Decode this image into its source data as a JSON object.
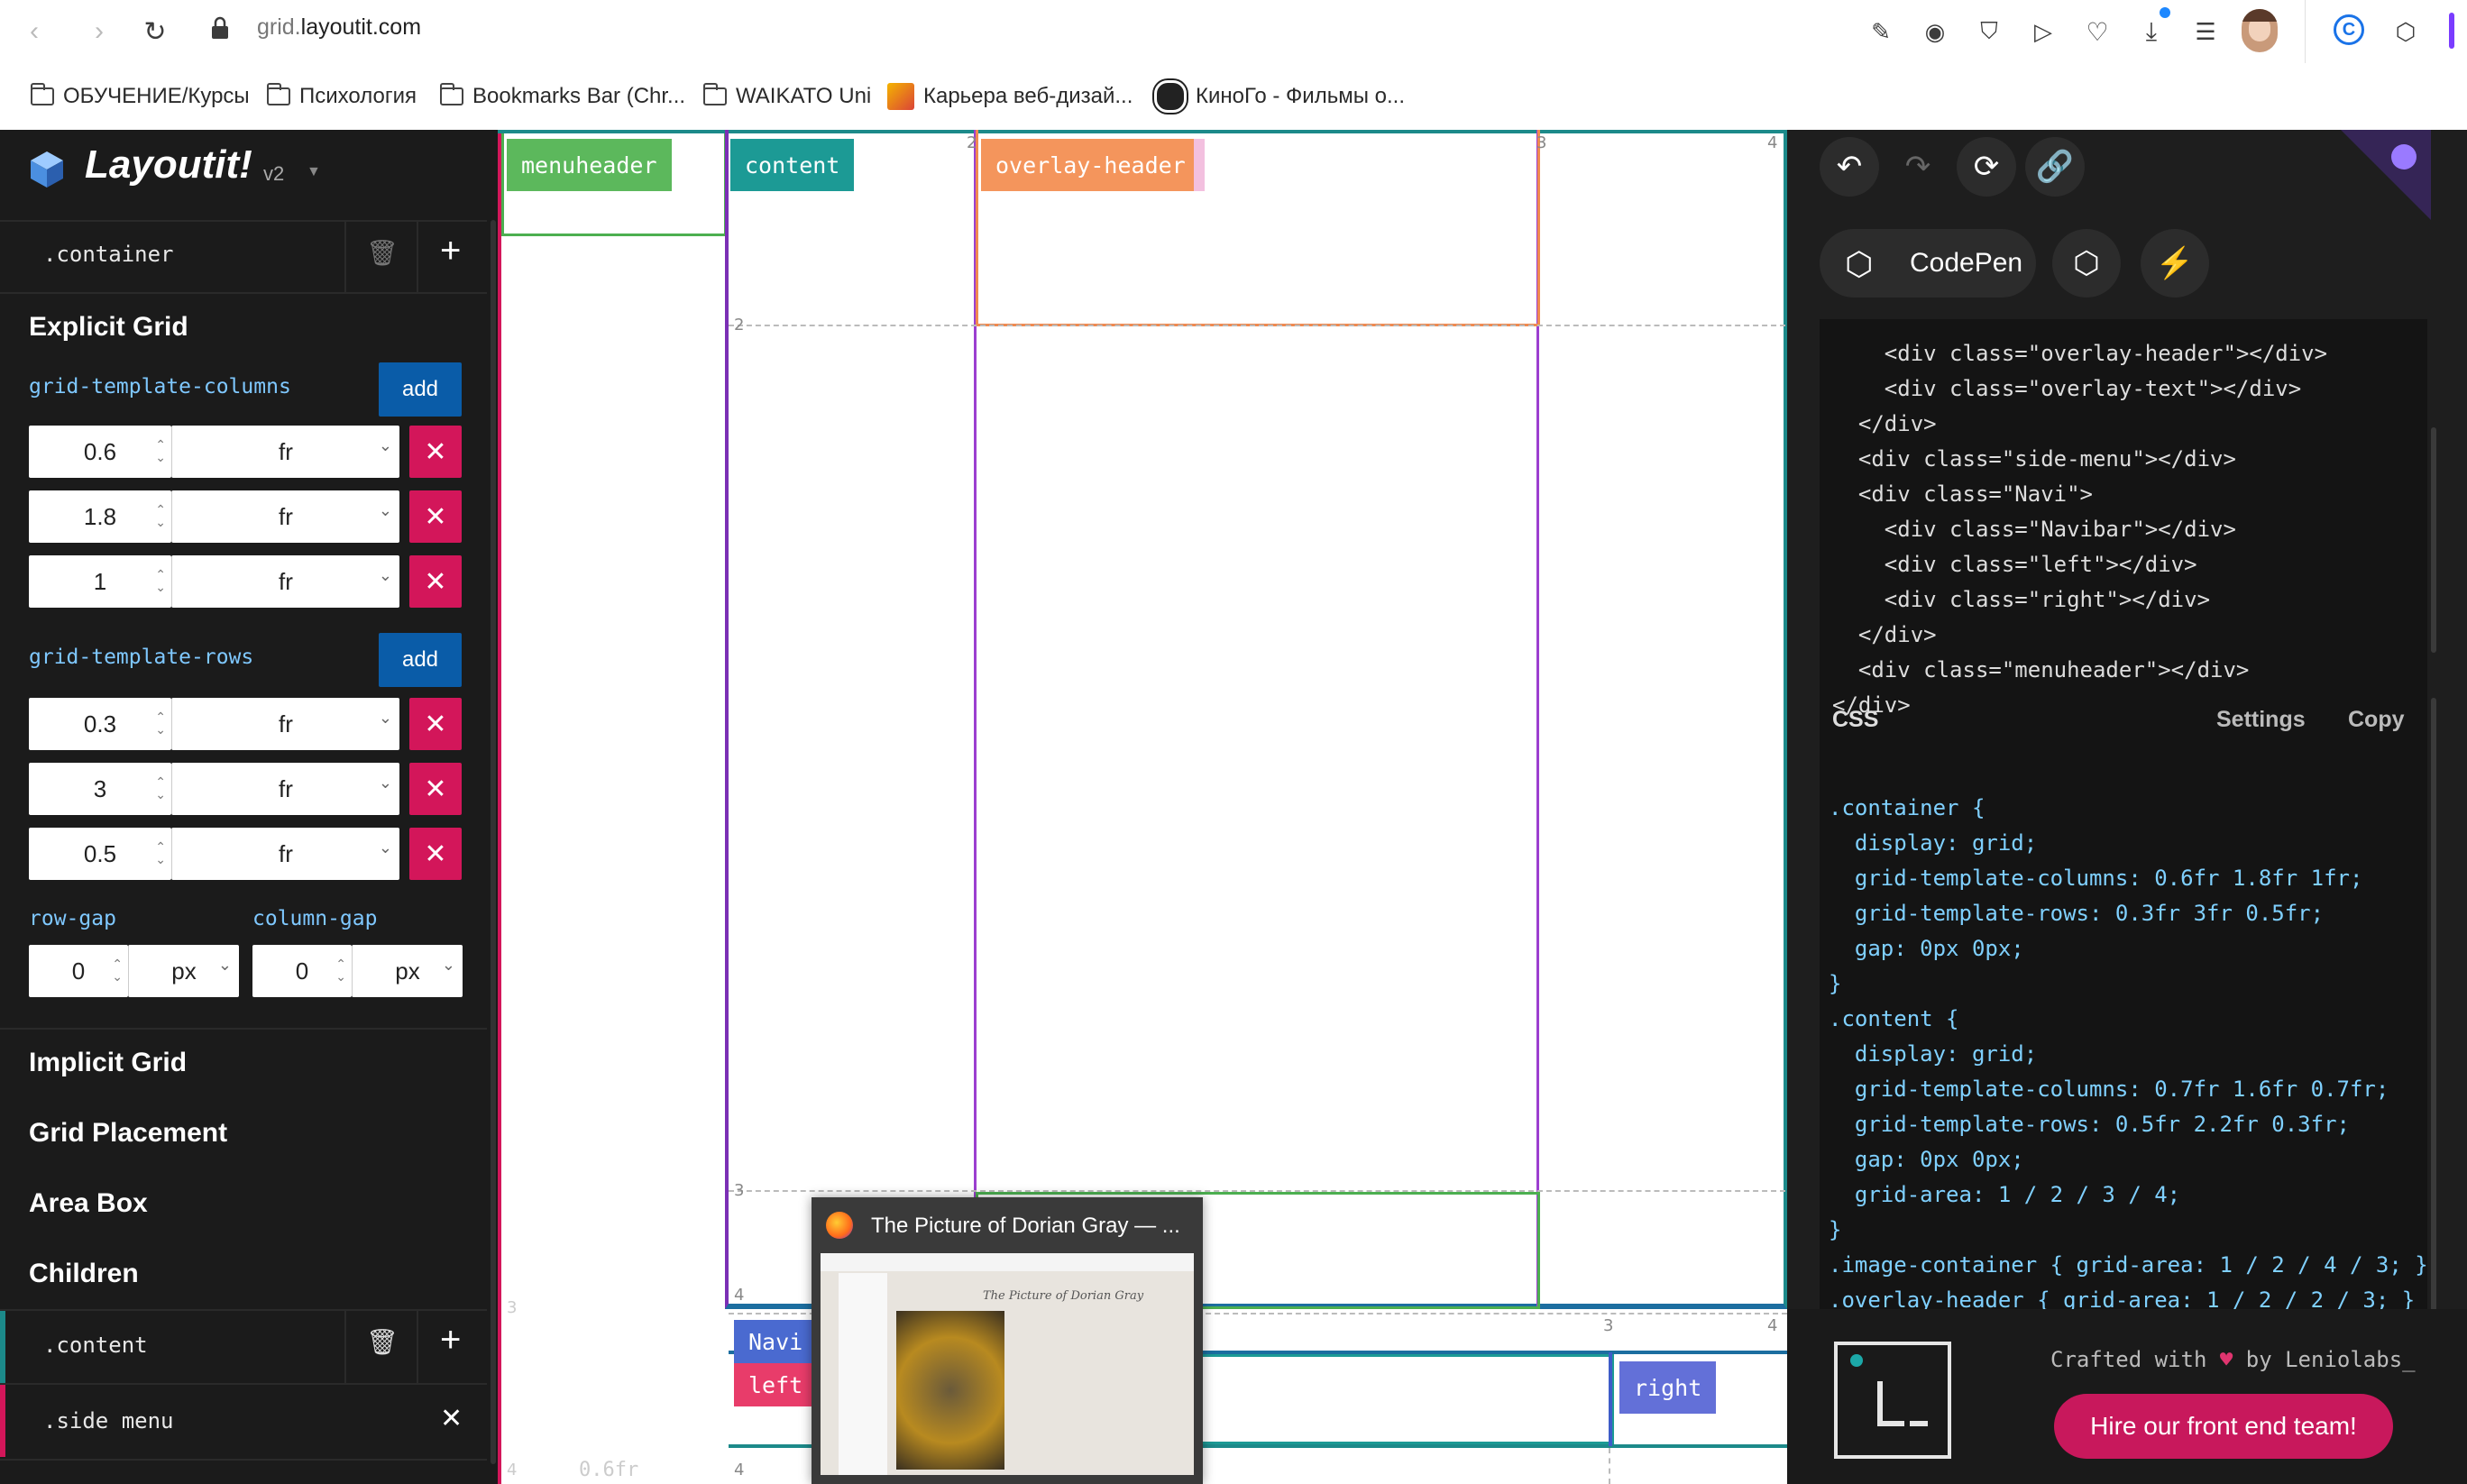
{
  "browser": {
    "url": "grid.layoutit.com",
    "url_domain": "grid.",
    "url_rest": "layoutit.com",
    "bookmarks": [
      {
        "label": "ОБУЧЕНИЕ/Курсы",
        "icon": "folder-icon"
      },
      {
        "label": "Психология",
        "icon": "folder-icon"
      },
      {
        "label": "Bookmarks Bar (Chr...",
        "icon": "folder-icon"
      },
      {
        "label": "WAIKATO Uni",
        "icon": "folder-icon"
      },
      {
        "label": "Карьера веб-дизай...",
        "icon": "site-icon"
      },
      {
        "label": "КиноГо - Фильмы о...",
        "icon": "site-icon"
      }
    ]
  },
  "app": {
    "title": "Layoutit!",
    "version": "v2",
    "container_selector": ".container",
    "explicit_grid_title": "Explicit Grid",
    "columns_label": "grid-template-columns",
    "rows_label": "grid-template-rows",
    "add_label": "add",
    "columns": [
      {
        "value": "0.6",
        "unit": "fr"
      },
      {
        "value": "1.8",
        "unit": "fr"
      },
      {
        "value": "1",
        "unit": "fr"
      }
    ],
    "rows": [
      {
        "value": "0.3",
        "unit": "fr"
      },
      {
        "value": "3",
        "unit": "fr"
      },
      {
        "value": "0.5",
        "unit": "fr"
      }
    ],
    "row_gap_label": "row-gap",
    "column_gap_label": "column-gap",
    "row_gap": {
      "value": "0",
      "unit": "px"
    },
    "column_gap": {
      "value": "0",
      "unit": "px"
    },
    "sections": [
      "Implicit Grid",
      "Grid Placement",
      "Area Box",
      "Children"
    ],
    "children": [
      ".content",
      ".side menu"
    ]
  },
  "canvas": {
    "areas": {
      "menuheader": "menuheader",
      "content": "content",
      "overlay_header": "overlay-header",
      "navi": "Navi",
      "left": "left",
      "right": "right",
      "navibar": "Navibar"
    },
    "ticks": {
      "t1": "2",
      "t2": "3",
      "t3": "4",
      "t4": "2",
      "t5": "3",
      "t6": "4",
      "t7": "3",
      "t8": "4",
      "t9": "3",
      "t10": "4",
      "t11": "4"
    },
    "col_size_hint": "0.6fr"
  },
  "popup": {
    "title": "The Picture of Dorian Gray — ...",
    "doc_title": "The Picture of Dorian Gray"
  },
  "right_panel": {
    "codepen_label": "CodePen",
    "html_lines": [
      "    <div class=\"overlay-header\"></div>",
      "    <div class=\"overlay-text\"></div>",
      "  </div>",
      "  <div class=\"side-menu\"></div>",
      "  <div class=\"Navi\">",
      "    <div class=\"Navibar\"></div>",
      "    <div class=\"left\"></div>",
      "    <div class=\"right\"></div>",
      "  </div>",
      "  <div class=\"menuheader\"></div>",
      "</div>"
    ],
    "css_title": "CSS",
    "settings_label": "Settings",
    "copy_label": "Copy",
    "css_lines": [
      ".container {",
      "  display: grid;",
      "  grid-template-columns: 0.6fr 1.8fr 1fr;",
      "  grid-template-rows: 0.3fr 3fr 0.5fr;",
      "  gap: 0px 0px;",
      "}",
      ".content {",
      "  display: grid;",
      "  grid-template-columns: 0.7fr 1.6fr 0.7fr;",
      "  grid-template-rows: 0.5fr 2.2fr 0.3fr;",
      "  gap: 0px 0px;",
      "  grid-area: 1 / 2 / 3 / 4;",
      "}",
      ".image-container { grid-area: 1 / 2 / 4 / 3; }",
      ".overlay-header { grid-area: 1 / 2 / 2 / 3; }"
    ],
    "crafted_text": "Crafted with",
    "crafted_by": "by Leniolabs_",
    "hire_label": "Hire our front end team!",
    "colors": {
      "heart": "#e0356f",
      "hire_bg": "#c8185c"
    }
  }
}
